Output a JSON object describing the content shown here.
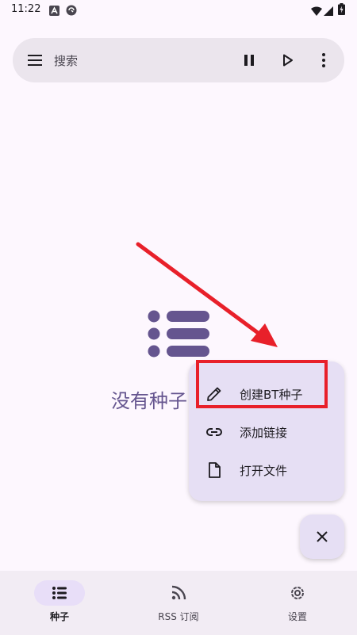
{
  "status_bar": {
    "time": "11:22",
    "left_icons": [
      "app-notification-icon",
      "sync-notification-icon"
    ],
    "right_icons": [
      "wifi-icon",
      "signal-icon",
      "battery-charging-icon"
    ]
  },
  "search": {
    "placeholder": "搜索",
    "icons": [
      "menu-icon",
      "pause-icon",
      "play-icon",
      "more-vert-icon"
    ]
  },
  "empty_state": {
    "icon": "list-icon",
    "text": "没有种子"
  },
  "fab_menu": {
    "items": [
      {
        "label": "创建BT种子",
        "icon": "pencil-icon"
      },
      {
        "label": "添加链接",
        "icon": "link-icon"
      },
      {
        "label": "打开文件",
        "icon": "file-icon"
      }
    ]
  },
  "fab": {
    "icon": "close-icon"
  },
  "bottom_nav": {
    "items": [
      {
        "label": "种子",
        "icon": "list-icon",
        "active": true
      },
      {
        "label": "RSS 订阅",
        "icon": "rss-icon",
        "active": false
      },
      {
        "label": "设置",
        "icon": "gear-icon",
        "active": false
      }
    ]
  },
  "colors": {
    "background": "#fdf7fe",
    "primary": "#65558f",
    "surface_container": "#e6dff4",
    "annotation_red": "#e8202a"
  }
}
